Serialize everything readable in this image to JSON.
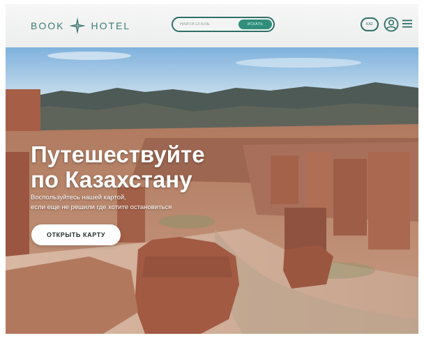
{
  "header": {
    "logo_left": "BOOK",
    "logo_right": "HOTEL",
    "search_placeholder": "НАЙТИ ОТЕЛЬ",
    "search_button": "ИСКАТЬ",
    "lang_label": "KAZ",
    "accent_color": "#2f6f66"
  },
  "hero": {
    "title_line1": "Путешествуйте",
    "title_line2": "по Казахстану",
    "subtitle_line1": "Воспользуйтесь нашей картой,",
    "subtitle_line2": "если еще не решили где хотите остановиться",
    "cta_label": "ОТКРЫТЬ КАРТУ"
  },
  "icons": {
    "logo": "compass-star-icon",
    "user": "user-circle-icon",
    "menu": "hamburger-menu-icon"
  }
}
